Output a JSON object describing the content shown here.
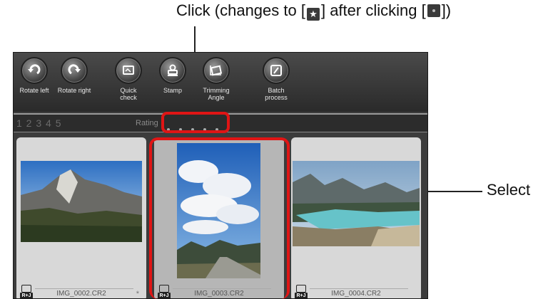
{
  "callouts": {
    "top_prefix": "Click (changes to [",
    "top_mid": "] after clicking [",
    "top_suffix": "])",
    "right": "Select"
  },
  "toolbar": {
    "tools": [
      {
        "label": "Rotate left",
        "icon": "rotate-left-icon"
      },
      {
        "label": "Rotate right",
        "icon": "rotate-right-icon"
      },
      {
        "label": "Quick check",
        "icon": "quick-check-icon"
      },
      {
        "label": "Stamp",
        "icon": "stamp-icon"
      },
      {
        "label": "Trimming Angle",
        "icon": "trimming-angle-icon"
      },
      {
        "label": "Batch process",
        "icon": "batch-process-icon"
      }
    ]
  },
  "rating_bar": {
    "numbers": "1 2 3 4 5",
    "label": "Rating"
  },
  "thumbnails": [
    {
      "filename": "IMG_0002.CR2",
      "badge": "R+J",
      "mark": "*",
      "selected": false
    },
    {
      "filename": "IMG_0003.CR2",
      "badge": "R+J",
      "mark": "",
      "selected": true
    },
    {
      "filename": "IMG_0004.CR2",
      "badge": "R+J",
      "mark": "",
      "selected": false
    }
  ],
  "colors": {
    "highlight": "#e01515",
    "toolbar_bg": "#2a2a2a"
  }
}
